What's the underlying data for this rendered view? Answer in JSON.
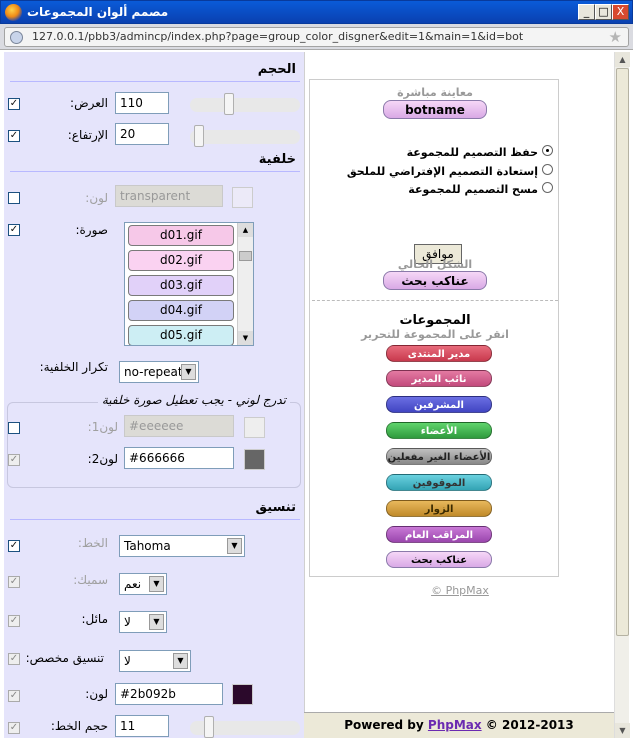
{
  "window": {
    "title": "مصمم ألوان المجموعات",
    "url": "127.0.0.1/pbb3/admincp/index.php?page=group_color_disgner&edit=1&main=1&id=bot",
    "btn_min": "_",
    "btn_max": "□",
    "btn_close": "X"
  },
  "size": {
    "heading": "الحجم",
    "width_label": ":العرض",
    "width_value": "110",
    "height_label": ":الإرتفاع",
    "height_value": "20"
  },
  "background": {
    "heading": "خلفية",
    "color_label": ":لون",
    "color_value": "transparent",
    "image_label": ":صورة",
    "images": [
      "d01.gif",
      "d02.gif",
      "d03.gif",
      "d04.gif",
      "d05.gif"
    ],
    "repeat_label": ":تكرار الخلفية",
    "repeat_value": "no-repeat",
    "gradient_legend": "تدرج لوني - يجب تعطيل صورة خلفية",
    "color1_label": ":لون1",
    "color1_value": "#eeeeee",
    "color2_label": ":لون2",
    "color2_value": "#666666"
  },
  "format": {
    "heading": "تنسيق",
    "font_label": ":الخط",
    "font_value": "Tahoma",
    "bold_label": ":سميك",
    "bold_value": "نعم",
    "italic_label": ":مائل",
    "italic_value": "لا",
    "custom_label": ":تنسيق مخصص",
    "custom_value": "لا",
    "color_label": ":لون",
    "color_value": "#2b092b",
    "size_label": ":حجم الخط",
    "size_value": "11"
  },
  "preview": {
    "live_label": "معاينة مباشرة",
    "live_button": "botname",
    "option_save": "حفظ التصميم للمجموعة",
    "option_restore": "إستعادة التصميم الإفتراضي للملحق",
    "option_delete": "مسح التصميم للمجموعة",
    "ok_label": "موافق",
    "current_label": "الشكل الحالي",
    "current_button": "عناكب بحث",
    "groups_title": "المجموعات",
    "groups_hint": "انقر على المجموعة للتحرير",
    "groups": [
      "مدير المنتدى",
      "نائب المدير",
      "المشرفين",
      "الأعضاء",
      "الأعضاء الغير مفعلين",
      "الموقوفين",
      "الزوار",
      "المراقب العام",
      "عناكب بحث"
    ],
    "copyright": "© PhpMax"
  },
  "footer": {
    "powered": "Powered by ",
    "brand": "PhpMax",
    "year": " © 2012-2013"
  },
  "colors": {
    "title_bar": "#0a4fc8",
    "left_panel": "#e5e4fb",
    "footer_link": "#6b2bb1"
  }
}
